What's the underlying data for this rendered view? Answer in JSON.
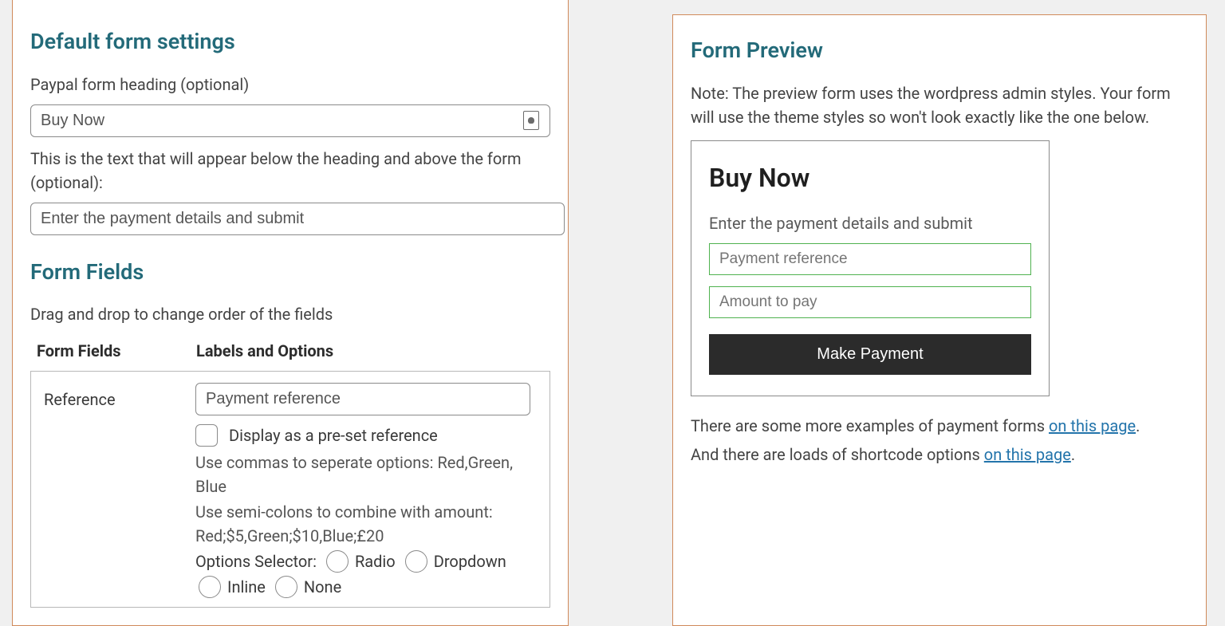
{
  "left": {
    "section_default": "Default form settings",
    "heading_label": "Paypal form heading (optional)",
    "heading_value": "Buy Now",
    "desc_label": "This is the text that will appear below the heading and above the form (optional):",
    "desc_value": "Enter the payment details and submit",
    "section_fields": "Form Fields",
    "drag_note": "Drag and drop to change order of the fields",
    "col1": "Form Fields",
    "col2": "Labels and Options",
    "row": {
      "name": "Reference",
      "label_value": "Payment reference",
      "preset_label": "Display as a pre-set reference",
      "hint1": "Use commas to seperate options: Red,Green, Blue",
      "hint2": "Use semi-colons to combine with amount: Red;$5,Green;$10,Blue;£20",
      "selector_label": "Options Selector:",
      "opt_radio": "Radio",
      "opt_dropdown": "Dropdown",
      "opt_inline": "Inline",
      "opt_none": "None"
    }
  },
  "right": {
    "section": "Form Preview",
    "note": "Note: The preview form uses the wordpress admin styles. Your form will use the theme styles so won't look exactly like the one below.",
    "title": "Buy Now",
    "subtitle": "Enter the payment details and submit",
    "ph_reference": "Payment reference",
    "ph_amount": "Amount to pay",
    "button": "Make Payment",
    "foot1_pre": "There are some more examples of payment forms ",
    "foot_link": "on this page",
    "foot1_post": ".",
    "foot2_pre": "And there are loads of shortcode options ",
    "foot2_post": "."
  }
}
